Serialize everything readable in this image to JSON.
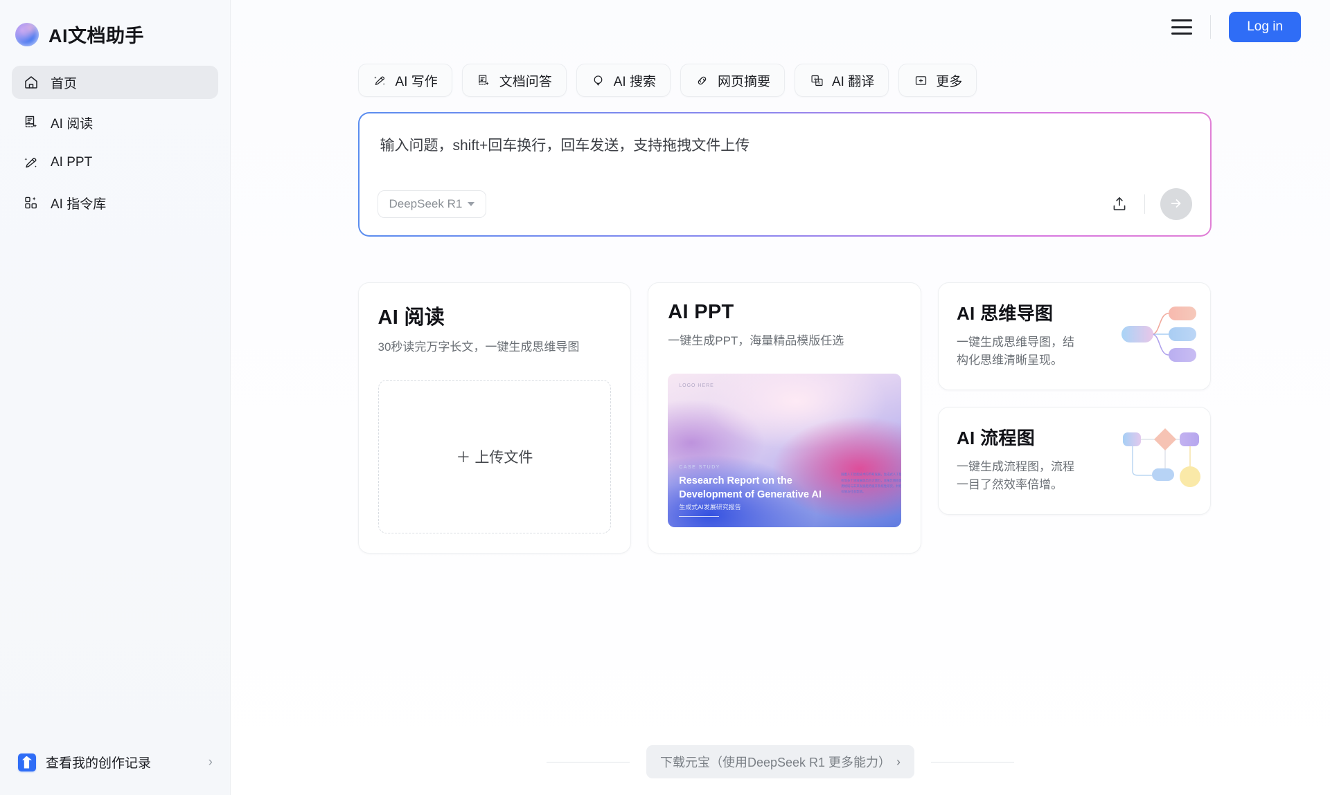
{
  "sidebar": {
    "brand": {
      "title": "AI文档助手",
      "logo_icon": "app-logo-icon"
    },
    "items": [
      {
        "label": "首页",
        "icon": "home-icon",
        "active": true
      },
      {
        "label": "AI 阅读",
        "icon": "document-sparkle-icon",
        "active": false
      },
      {
        "label": "AI PPT",
        "icon": "pencil-sparkle-icon",
        "active": false
      },
      {
        "label": "AI 指令库",
        "icon": "grid-sparkle-icon",
        "active": false
      }
    ],
    "footer": {
      "label": "查看我的创作记录",
      "icon": "upload-badge-icon",
      "chevron": "›"
    }
  },
  "topbar": {
    "menu_icon": "hamburger-menu-icon",
    "login_label": "Log in",
    "accent_color": "#2f6df6"
  },
  "tools": [
    {
      "label": "AI 写作",
      "icon": "pencil-sparkle-icon"
    },
    {
      "label": "文档问答",
      "icon": "document-sparkle-icon"
    },
    {
      "label": "AI 搜索",
      "icon": "search-bubble-icon"
    },
    {
      "label": "网页摘要",
      "icon": "link-icon"
    },
    {
      "label": "AI 翻译",
      "icon": "translate-icon"
    },
    {
      "label": "更多",
      "icon": "more-box-icon"
    }
  ],
  "prompt": {
    "placeholder": "输入问题，shift+回车换行，回车发送，支持拖拽文件上传",
    "model": "DeepSeek R1",
    "upload_icon": "upload-icon",
    "send_icon": "arrow-right-icon",
    "border_gradient": [
      "#5b8def",
      "#8d86ee",
      "#d778e0",
      "#e07fd6"
    ]
  },
  "cards": {
    "read": {
      "title": "AI 阅读",
      "subtitle": "30秒读完万字长文，一键生成思维导图",
      "dropzone_label": "上传文件",
      "dropzone_plus": "＋"
    },
    "ppt": {
      "title": "AI PPT",
      "subtitle": "一键生成PPT，海量精品模版任选",
      "thumb": {
        "logo": "LOGO HERE",
        "kicker": "CASE STUDY",
        "heading": "Research Report on the Development of Generative AI",
        "subheading": "生成式AI发展研究报告",
        "body": "随着人工智能技术的不断发展，生成式人工智能在内容创作、数据分析等多个领域展现出巨大潜力，本报告围绕其技术演进路径、产业应用格局与未来发展趋势展开系统性研究，并结合典型案例分析其商业价值与社会影响。"
      }
    },
    "mindmap": {
      "title": "AI 思维导图",
      "subtitle": "一键生成思维导图，结构化思维清晰呈现。",
      "art_icon": "mindmap-art-icon"
    },
    "flowchart": {
      "title": "AI 流程图",
      "subtitle": "一键生成流程图，流程一目了然效率倍增。",
      "art_icon": "flowchart-art-icon"
    }
  },
  "bottom": {
    "download_label": "下载元宝（使用DeepSeek R1 更多能力）",
    "chevron": "›"
  }
}
